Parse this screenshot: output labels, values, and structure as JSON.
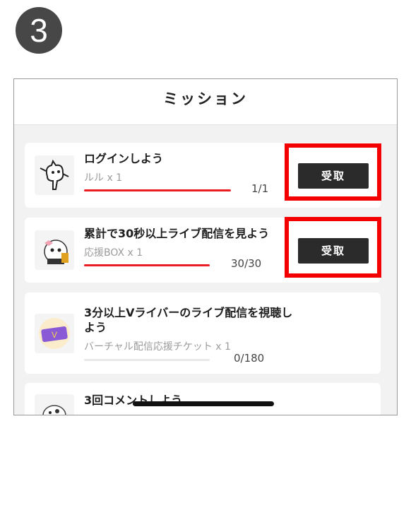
{
  "step": {
    "number": "3"
  },
  "header": {
    "title": "ミッション"
  },
  "missions": [
    {
      "title": "ログインしよう",
      "reward": "ルル x 1",
      "progress": "1/1",
      "progress_fraction": 1.0,
      "button": "受取",
      "highlighted": true,
      "icon": "cat-character-icon"
    },
    {
      "title": "累計で30秒以上ライブ配信を見よう",
      "reward": "応援BOX x 1",
      "progress": "30/30",
      "progress_fraction": 1.0,
      "button": "受取",
      "highlighted": true,
      "icon": "support-box-icon"
    },
    {
      "title": "3分以上Vライバーのライブ配信を視聴しよう",
      "reward": "バーチャル配信応援チケット x 1",
      "progress": "0/180",
      "progress_fraction": 0.0,
      "icon": "virtual-ticket-icon"
    },
    {
      "title": "3回コメントしよう",
      "icon": "dalmatian-icon"
    }
  ],
  "colors": {
    "accent": "#ec1c24",
    "highlight": "#f40000",
    "button_bg": "#2b2b2b"
  }
}
